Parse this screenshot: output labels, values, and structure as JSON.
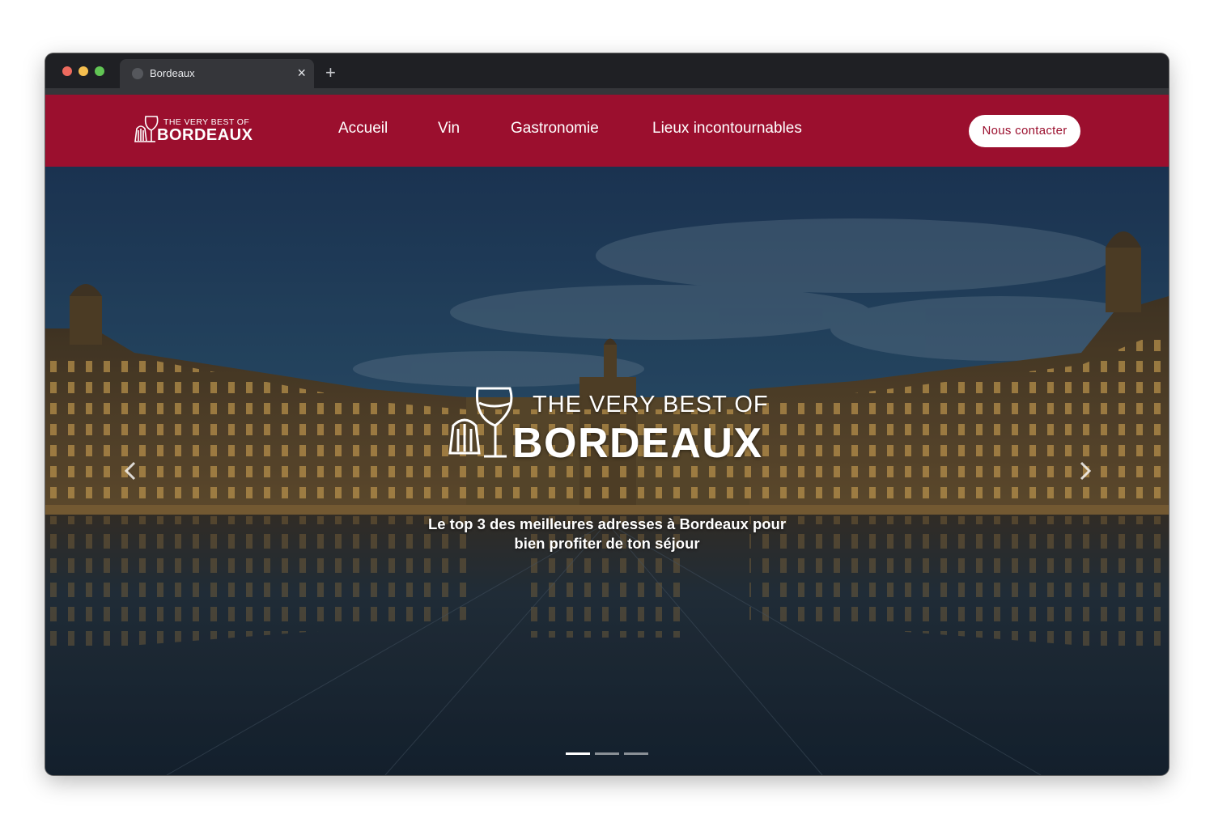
{
  "browser": {
    "tab_title": "Bordeaux",
    "close_symbol": "×",
    "new_tab_symbol": "+",
    "traffic_lights": {
      "close": "#ed6a5e",
      "minimize": "#f5bf4f",
      "zoom": "#61c554"
    }
  },
  "header": {
    "logo": {
      "top_text": "THE VERY BEST OF",
      "main_text": "BORDEAUX"
    },
    "nav": [
      {
        "label": "Accueil"
      },
      {
        "label": "Vin"
      },
      {
        "label": "Gastronomie"
      },
      {
        "label": "Lieux incontournables"
      }
    ],
    "cta_label": "Nous contacter"
  },
  "hero": {
    "logo": {
      "top_text": "THE VERY BEST OF",
      "main_text": "BORDEAUX"
    },
    "tagline_line1": "Le top 3 des meilleures adresses à Bordeaux pour",
    "tagline_line2": "bien profiter de ton séjour",
    "carousel": {
      "slide_count": 3,
      "active_index": 0,
      "prev_icon": "chevron-left-icon",
      "next_icon": "chevron-right-icon"
    }
  },
  "colors": {
    "brand": "#9b0f2e",
    "chrome": "#1f2024",
    "tab": "#35363a"
  }
}
